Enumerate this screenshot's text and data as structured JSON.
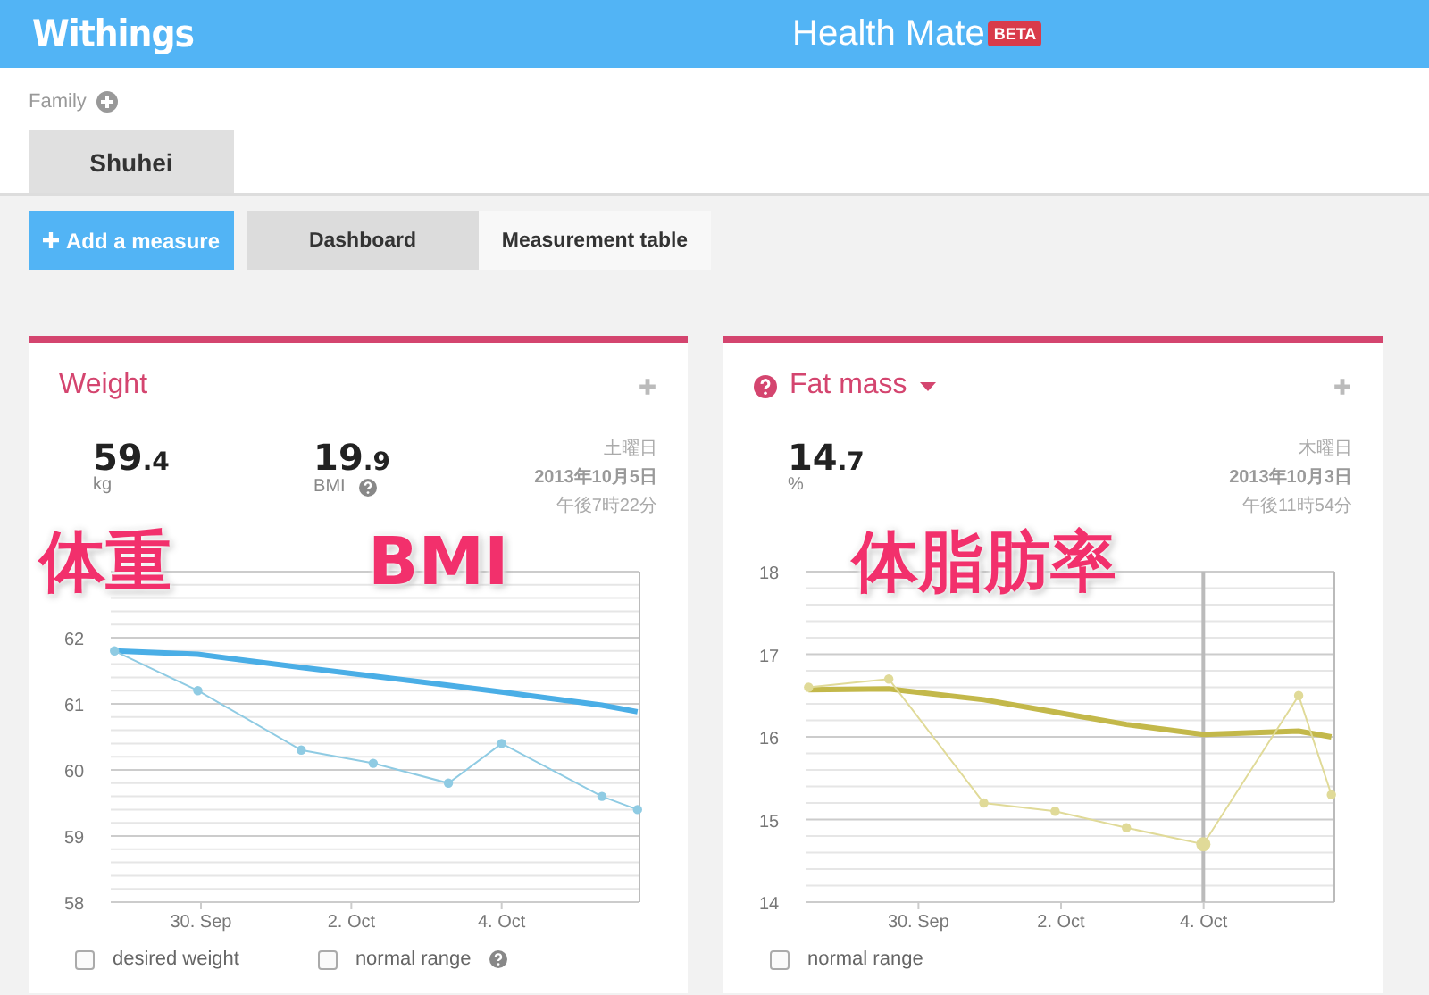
{
  "header": {
    "brand": "Withings",
    "title": "Health Mate",
    "badge": "BETA"
  },
  "family": {
    "label": "Family",
    "members": [
      {
        "name": "Shuhei",
        "selected": true
      }
    ]
  },
  "add_button": "Add a measure",
  "views": [
    {
      "label": "Dashboard",
      "selected": true
    },
    {
      "label": "Measurement table",
      "selected": false
    }
  ],
  "cards": [
    {
      "title": "Weight",
      "help": false,
      "dropdown": false,
      "stats": [
        {
          "whole": "59",
          "decimal": ".4",
          "unit": "kg",
          "help": false
        },
        {
          "whole": "19",
          "decimal": ".9",
          "unit": "BMI",
          "help": true
        }
      ],
      "date": [
        "土曜日",
        "2013年10月5日",
        "午後7時22分"
      ],
      "overlay_labels": [
        "体重",
        "BMI"
      ],
      "chart_data": {
        "type": "line",
        "x": [
          "2013-09-28T20:24",
          "2013-09-29T23:00",
          "2013-10-01T08:00",
          "2013-10-02T07:00",
          "2013-10-03T07:00",
          "2013-10-04T00:00",
          "2013-10-05T08:00",
          "2013-10-05T19:22"
        ],
        "series": [
          {
            "color": "#4aaee6",
            "values": [
              61.8,
              61.75,
              61.55,
              61.42,
              61.28,
              61.18,
              60.98,
              60.88
            ]
          },
          {
            "color": "#8fcbe3",
            "marker": true,
            "values": [
              61.8,
              61.2,
              60.3,
              60.1,
              59.8,
              60.4,
              59.6,
              59.4
            ]
          }
        ],
        "xlim": [
          "2013-09-28T19:12",
          "2013-10-05T20:00"
        ],
        "grid": true,
        "ylim": [
          58,
          63
        ],
        "yticks": [
          58,
          59,
          60,
          61,
          62
        ],
        "xticks": [
          {
            "value": "2013-09-30",
            "label": "30. Sep"
          },
          {
            "value": "2013-10-02",
            "label": "2. Oct"
          },
          {
            "value": "2013-10-04",
            "label": "4. Oct"
          }
        ]
      },
      "options": [
        {
          "label": "desired weight",
          "checked": false,
          "help": false
        },
        {
          "label": "normal range",
          "checked": false,
          "help": true
        }
      ]
    },
    {
      "title": "Fat mass",
      "help": true,
      "dropdown": true,
      "stats": [
        {
          "whole": "14",
          "decimal": ".7",
          "unit": "%",
          "help": false
        }
      ],
      "date": [
        "木曜日",
        "2013年10月3日",
        "午後11時54分"
      ],
      "overlay_labels": [
        "体脂肪率"
      ],
      "chart_data": {
        "type": "line",
        "x": [
          "2013-09-28T11:00",
          "2013-09-29T14:00",
          "2013-09-30T22:00",
          "2013-10-01T22:00",
          "2013-10-02T22:00",
          "2013-10-03T23:54",
          "2013-10-05T08:00",
          "2013-10-05T19:00"
        ],
        "series": [
          {
            "color": "#c3b84a",
            "values": [
              16.57,
              16.58,
              16.45,
              16.3,
              16.15,
              16.03,
              16.07,
              16.0
            ]
          },
          {
            "color": "#e0da98",
            "marker": true,
            "values": [
              16.6,
              16.7,
              15.2,
              15.1,
              14.9,
              14.7,
              16.5,
              15.3
            ]
          }
        ],
        "xlim": [
          "2013-09-28T10:00",
          "2013-10-05T20:00"
        ],
        "grid": true,
        "ylim": [
          14,
          18
        ],
        "yticks": [
          14,
          15,
          16,
          17,
          18
        ],
        "xticks": [
          {
            "value": "2013-09-30",
            "label": "30. Sep"
          },
          {
            "value": "2013-10-02",
            "label": "2. Oct"
          },
          {
            "value": "2013-10-04",
            "label": "4. Oct"
          }
        ],
        "ref_lines": [
          {
            "axis": "x",
            "value": "2013-10-03T23:54"
          }
        ]
      },
      "options": [
        {
          "label": "normal range",
          "checked": false,
          "help": false
        }
      ]
    }
  ]
}
